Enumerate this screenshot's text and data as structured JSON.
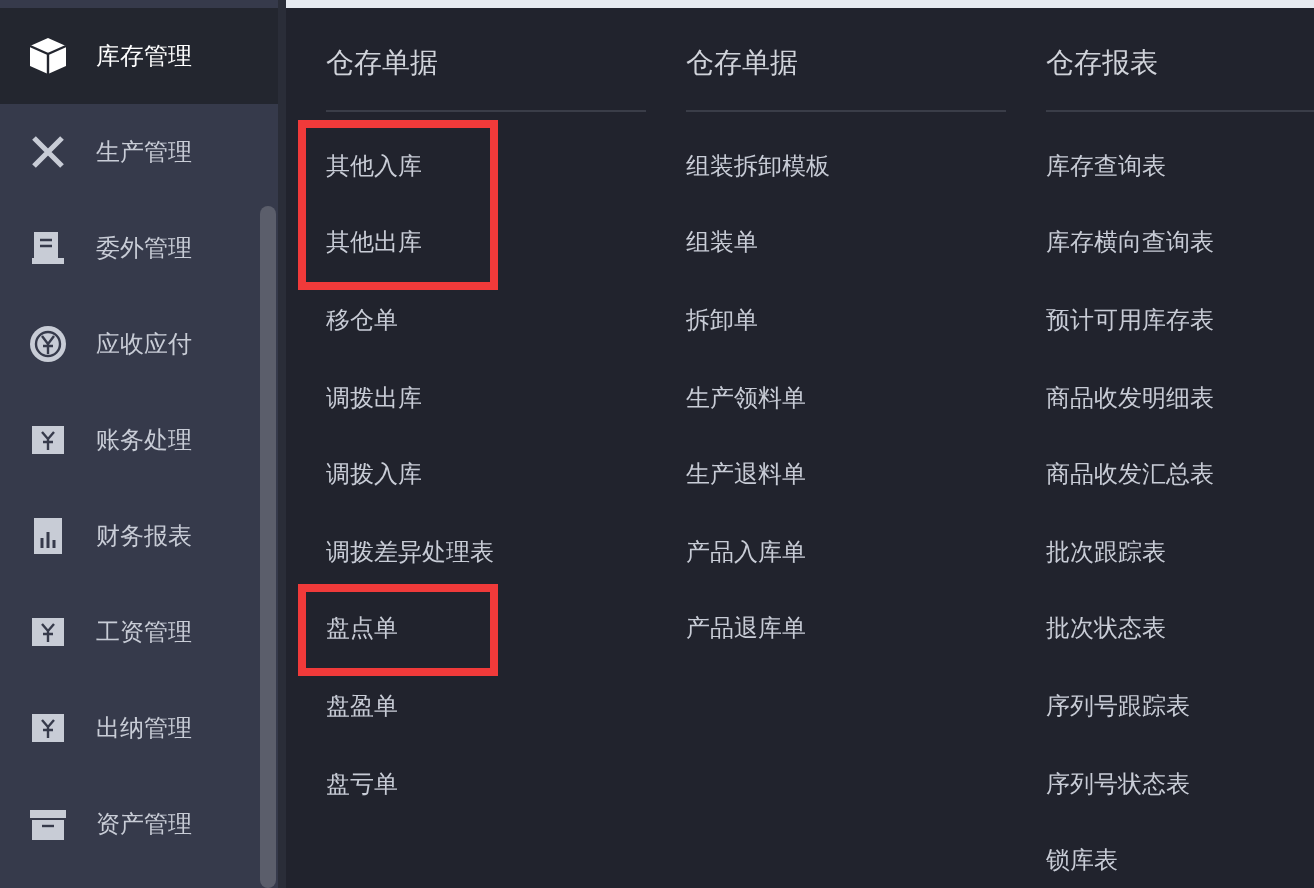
{
  "sidebar": {
    "items": [
      {
        "label": "库存管理",
        "selected": true
      },
      {
        "label": "生产管理",
        "selected": false
      },
      {
        "label": "委外管理",
        "selected": false
      },
      {
        "label": "应收应付",
        "selected": false
      },
      {
        "label": "账务处理",
        "selected": false
      },
      {
        "label": "财务报表",
        "selected": false
      },
      {
        "label": "工资管理",
        "selected": false
      },
      {
        "label": "出纳管理",
        "selected": false
      },
      {
        "label": "资产管理",
        "selected": false
      }
    ]
  },
  "menu": {
    "columns": [
      {
        "heading": "仓存单据",
        "items": [
          {
            "label": "其他入库",
            "highlighted": true
          },
          {
            "label": "其他出库",
            "highlighted": true
          },
          {
            "label": "移仓单",
            "highlighted": false
          },
          {
            "label": "调拨出库",
            "highlighted": false
          },
          {
            "label": "调拨入库",
            "highlighted": false
          },
          {
            "label": "调拨差异处理表",
            "highlighted": false
          },
          {
            "label": "盘点单",
            "highlighted": true
          },
          {
            "label": "盘盈单",
            "highlighted": false
          },
          {
            "label": "盘亏单",
            "highlighted": false
          }
        ]
      },
      {
        "heading": "仓存单据",
        "items": [
          {
            "label": "组装拆卸模板",
            "highlighted": false
          },
          {
            "label": "组装单",
            "highlighted": false
          },
          {
            "label": "拆卸单",
            "highlighted": false
          },
          {
            "label": "生产领料单",
            "highlighted": false
          },
          {
            "label": "生产退料单",
            "highlighted": false
          },
          {
            "label": "产品入库单",
            "highlighted": false
          },
          {
            "label": "产品退库单",
            "highlighted": false
          }
        ]
      },
      {
        "heading": "仓存报表",
        "items": [
          {
            "label": "库存查询表",
            "highlighted": false
          },
          {
            "label": "库存横向查询表",
            "highlighted": false
          },
          {
            "label": "预计可用库存表",
            "highlighted": false
          },
          {
            "label": "商品收发明细表",
            "highlighted": false
          },
          {
            "label": "商品收发汇总表",
            "highlighted": false
          },
          {
            "label": "批次跟踪表",
            "highlighted": false
          },
          {
            "label": "批次状态表",
            "highlighted": false
          },
          {
            "label": "序列号跟踪表",
            "highlighted": false
          },
          {
            "label": "序列号状态表",
            "highlighted": false
          },
          {
            "label": "锁库表",
            "highlighted": false
          }
        ]
      }
    ]
  }
}
